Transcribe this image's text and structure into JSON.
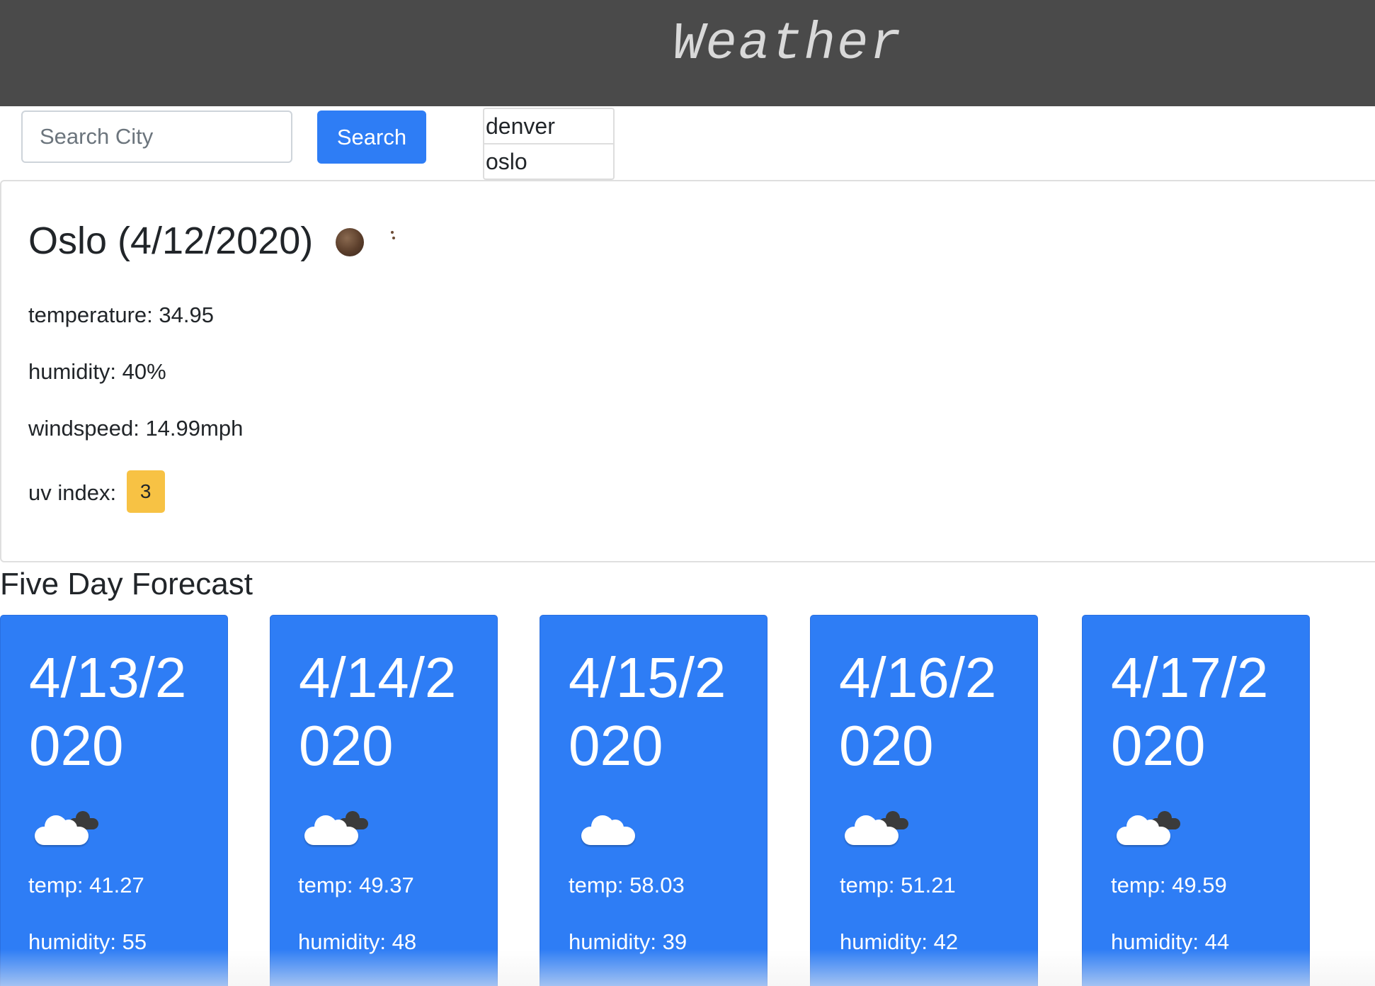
{
  "header": {
    "title": "Weather"
  },
  "search": {
    "placeholder": "Search City",
    "value": "",
    "button_label": "Search"
  },
  "history": {
    "items": [
      "denver",
      "oslo"
    ]
  },
  "current": {
    "title": "Oslo (4/12/2020)",
    "icon": "moon-icon",
    "temperature": "temperature: 34.95",
    "humidity": "humidity: 40%",
    "windspeed": "windspeed: 14.99mph",
    "uv_label": "uv index:",
    "uv_value": "3",
    "uv_color": "#f7c244"
  },
  "forecast": {
    "heading": "Five Day Forecast",
    "card_color": "#2e7df5",
    "days": [
      {
        "date": "4/13/2020",
        "icon": "partly-cloudy-icon",
        "temp": "temp: 41.27",
        "humidity": "humidity: 55"
      },
      {
        "date": "4/14/2020",
        "icon": "partly-cloudy-icon",
        "temp": "temp: 49.37",
        "humidity": "humidity: 48"
      },
      {
        "date": "4/15/2020",
        "icon": "cloud-icon",
        "temp": "temp: 58.03",
        "humidity": "humidity: 39"
      },
      {
        "date": "4/16/2020",
        "icon": "partly-cloudy-icon",
        "temp": "temp: 51.21",
        "humidity": "humidity: 42"
      },
      {
        "date": "4/17/2020",
        "icon": "partly-cloudy-icon",
        "temp": "temp: 49.59",
        "humidity": "humidity: 44"
      }
    ]
  }
}
